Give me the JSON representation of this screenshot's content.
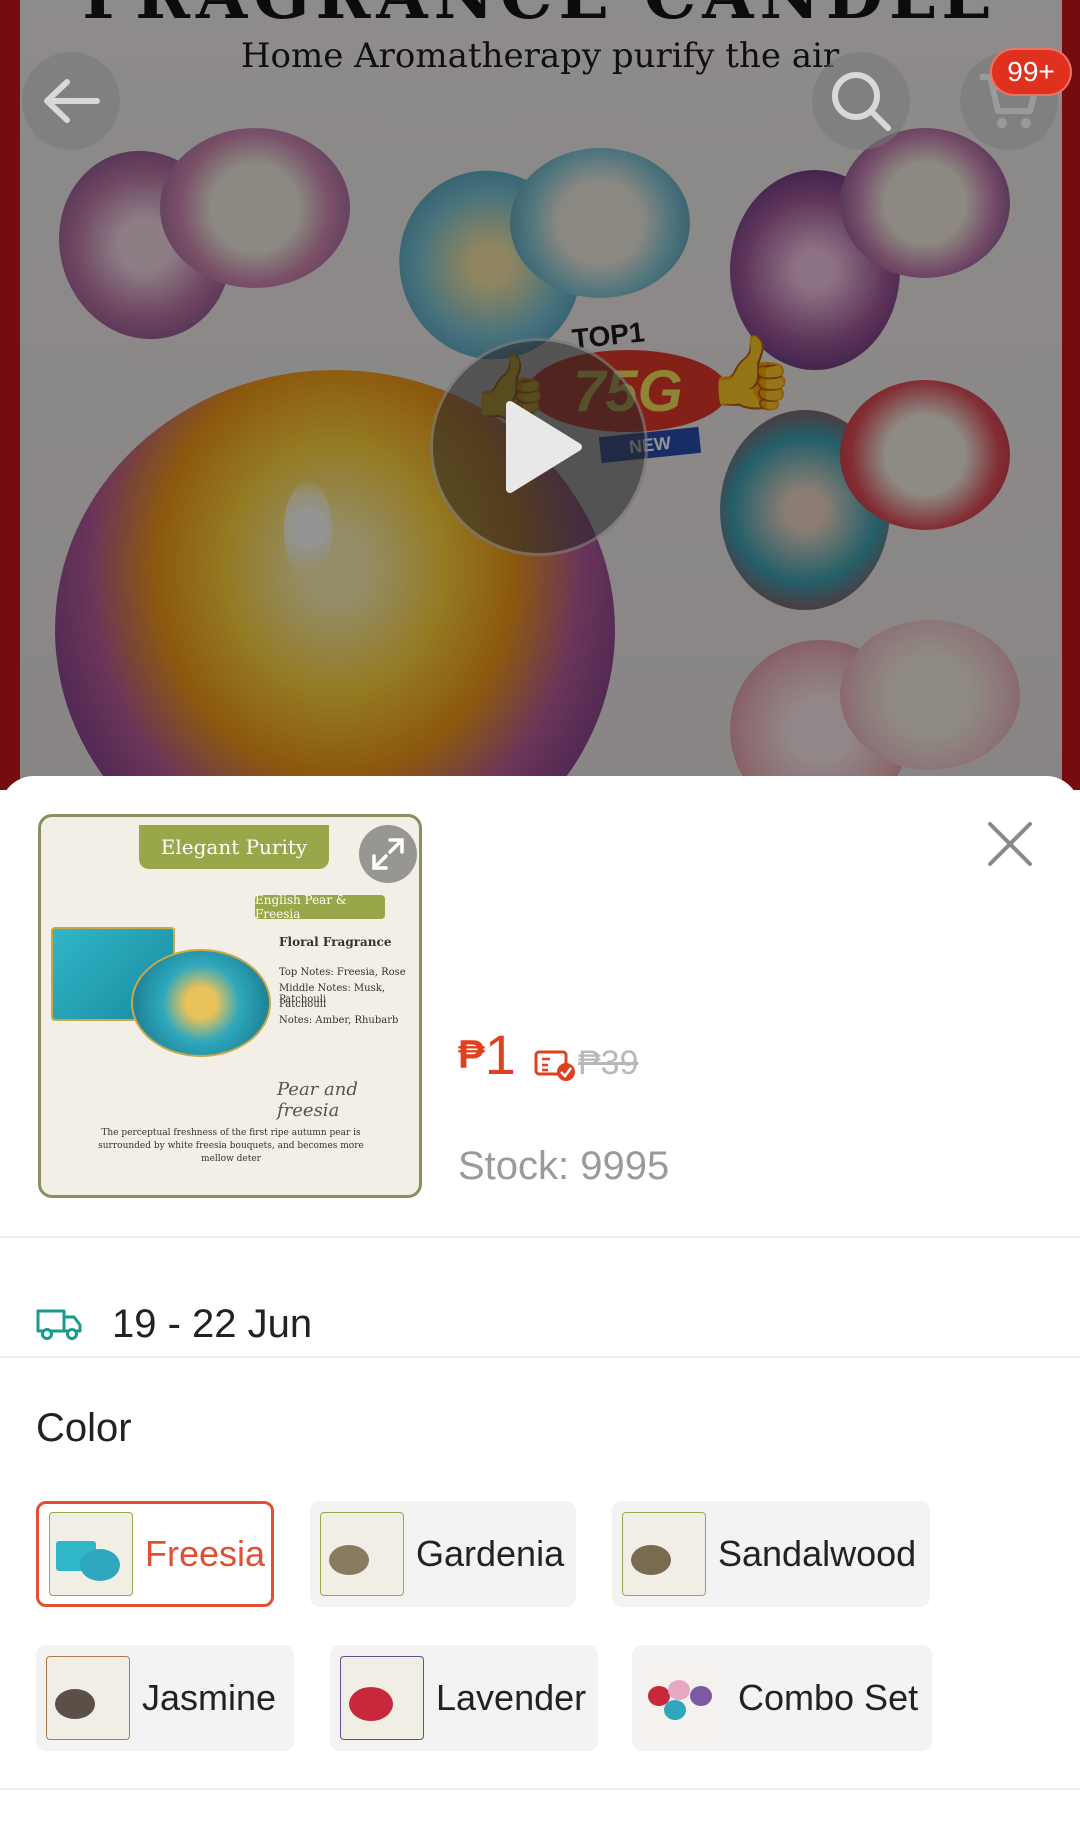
{
  "hero": {
    "title": "FRAGRANCE CANDLE",
    "subtitle": "Home Aromatherapy purify the air",
    "badge_top": "TOP1",
    "badge_mid": "75G",
    "badge_bottom": "NEW",
    "cart_count": "99+"
  },
  "icons": {
    "back": "back-arrow-icon",
    "search": "search-icon",
    "cart": "cart-icon",
    "play": "play-icon",
    "close": "close-icon",
    "expand": "expand-icon",
    "delivery": "truck-icon",
    "voucher": "voucher-icon"
  },
  "product_thumb": {
    "header": "Elegant Purity",
    "variant_tag": "English Pear & Freesia",
    "category": "Floral Fragrance",
    "notes": [
      "Top Notes: Freesia, Rose",
      "Middle Notes: Musk, Patchouli",
      "Patchouli",
      "Notes:  Amber, Rhubarb"
    ],
    "script": "Pear and freesia",
    "description": "The perceptual freshness of the first ripe autumn pear is surrounded by white freesia bouquets, and becomes more mellow deter"
  },
  "pricing": {
    "currency": "₱",
    "price": "1",
    "original_price": "₱39",
    "stock_label": "Stock: 9995"
  },
  "delivery": {
    "date_range": "19 - 22 Jun"
  },
  "variants": {
    "title": "Color",
    "selected": "Freesia",
    "options": [
      "Freesia",
      "Gardenia",
      "Sandalwood",
      "Jasmine",
      "Lavender",
      "Combo Set"
    ]
  },
  "colors": {
    "accent": "#e24f32",
    "price": "#e0401f",
    "badge": "#e0301e",
    "delivery_icon": "#1a9a8c"
  }
}
